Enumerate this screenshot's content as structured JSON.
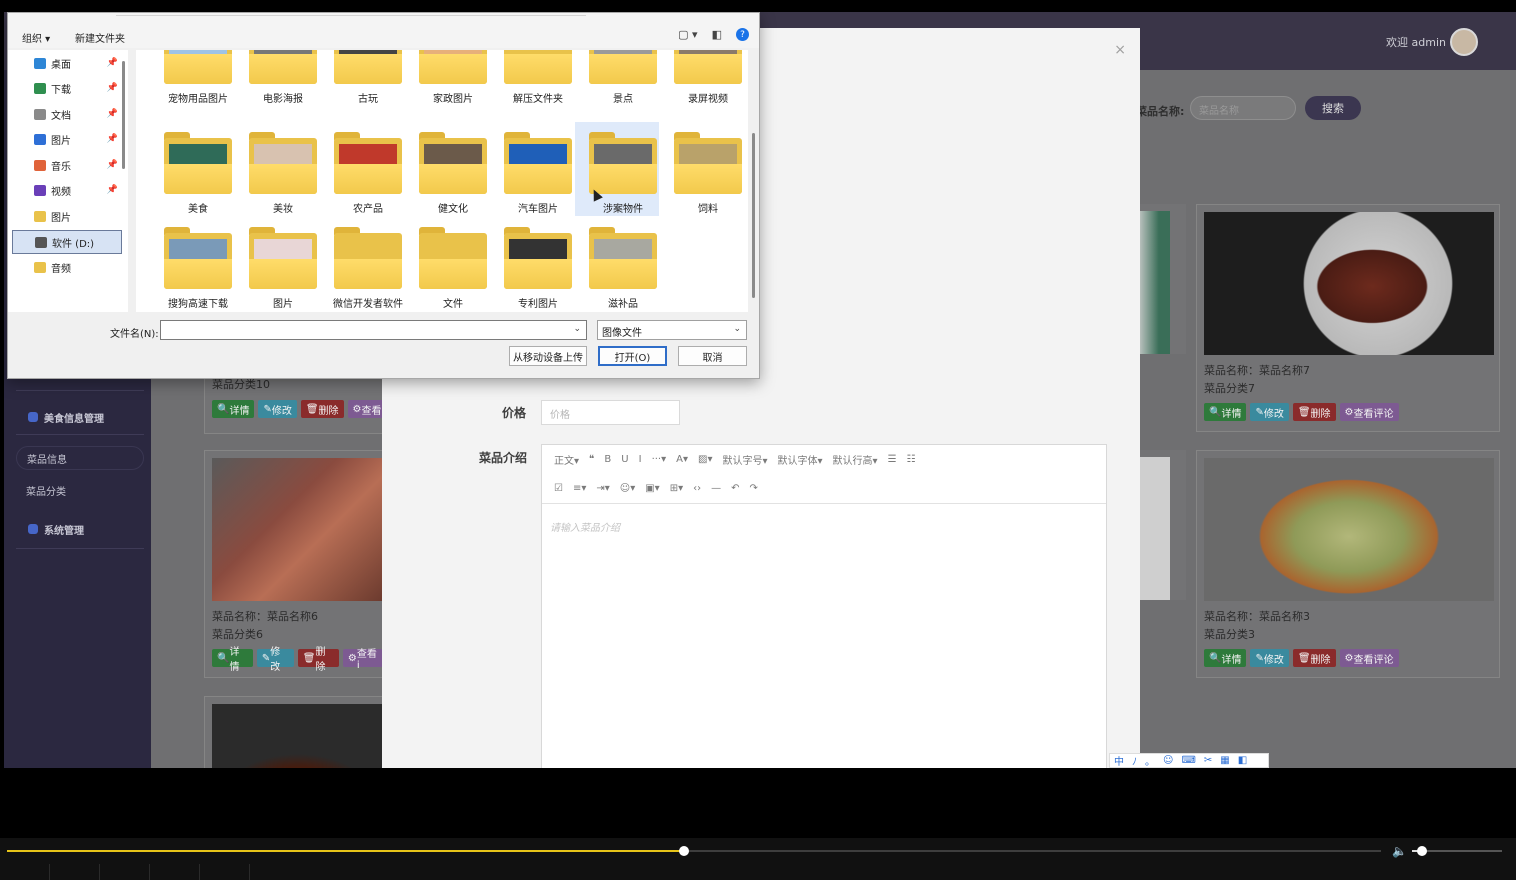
{
  "admin": {
    "welcome": "欢迎 admin",
    "sidebar": {
      "group_food": "美食信息管理",
      "sub_food_info": "菜品信息",
      "sub_food_category": "菜品分类",
      "group_system": "系统管理"
    },
    "search": {
      "label": "菜品名称:",
      "placeholder": "菜品名称",
      "button": "搜索"
    },
    "cards": [
      {
        "name": "菜品名称：菜品名称7",
        "category": "菜品分类7"
      },
      {
        "name": "菜品名称：菜品名称6",
        "category": "菜品分类6"
      },
      {
        "name": "菜品名称：菜品名称3",
        "category": "菜品分类3"
      },
      {
        "name": "",
        "category": "菜品分类10"
      }
    ],
    "card_buttons": {
      "detail": "详情",
      "edit": "修改",
      "delete": "删除",
      "comments": "查看评论",
      "comments_short": "查看i"
    }
  },
  "editor_modal": {
    "price_label": "价格",
    "price_placeholder": "价格",
    "intro_label": "菜品介绍",
    "toolbar_row1": [
      "正文▾",
      "❝",
      "B",
      "U",
      "I",
      "···▾",
      "A▾",
      "▨▾",
      "默认字号▾",
      "默认字体▾",
      "默认行高▾",
      "☰",
      "☷"
    ],
    "toolbar_row2": [
      "☑",
      "≡▾",
      "⇥▾",
      "☺▾",
      "▣▾",
      "⊞▾",
      "‹›",
      "—",
      "↶",
      "↷"
    ],
    "editor_placeholder": "请输入菜品介绍",
    "close": "×",
    "ime": [
      "中",
      "ﾉ",
      "。",
      "☺",
      "⌨",
      "✂",
      "▦",
      "◧"
    ]
  },
  "file_dialog": {
    "organize": "组织 ▾",
    "new_folder": "新建文件夹",
    "nav": [
      {
        "label": "桌面",
        "pinned": true,
        "color": "#2e86d6"
      },
      {
        "label": "下载",
        "pinned": true,
        "color": "#2f8f4f"
      },
      {
        "label": "文档",
        "pinned": true,
        "color": "#8a8a8a"
      },
      {
        "label": "图片",
        "pinned": true,
        "color": "#2e6fd6"
      },
      {
        "label": "音乐",
        "pinned": true,
        "color": "#e0633a"
      },
      {
        "label": "视频",
        "pinned": true,
        "color": "#6a3fb8"
      },
      {
        "label": "图片",
        "pinned": false,
        "color": "#e9c24a"
      },
      {
        "label": "软件 (D:)",
        "pinned": false,
        "color": "#555555"
      },
      {
        "label": "音频",
        "pinned": false,
        "color": "#e9c24a"
      }
    ],
    "folders": [
      {
        "name": "宠物用品图片",
        "thumb": "#9ec3e6"
      },
      {
        "name": "电影海报",
        "thumb": "#777777"
      },
      {
        "name": "古玩",
        "thumb": "#444444"
      },
      {
        "name": "家政图片",
        "thumb": "#e7b07a"
      },
      {
        "name": "解压文件夹",
        "thumb": ""
      },
      {
        "name": "景点",
        "thumb": "#9a9a9a"
      },
      {
        "name": "录屏视频",
        "thumb": "#8a7a6a"
      },
      {
        "name": "美食",
        "thumb": "#2f6b58"
      },
      {
        "name": "美妆",
        "thumb": "#d8c2b0"
      },
      {
        "name": "农产品",
        "thumb": "#c0392b"
      },
      {
        "name": "健文化",
        "thumb": "#6b5a4a"
      },
      {
        "name": "汽车图片",
        "thumb": "#1f5fb8"
      },
      {
        "name": "涉案物件",
        "thumb": "#6a6a6a"
      },
      {
        "name": "饲料",
        "thumb": "#b9a26a"
      },
      {
        "name": "搜狗高速下载",
        "thumb": "#7a9ab8"
      },
      {
        "name": "图片",
        "thumb": "#e8d6d6"
      },
      {
        "name": "微信开发者软件",
        "thumb": ""
      },
      {
        "name": "文件",
        "thumb": ""
      },
      {
        "name": "专利图片",
        "thumb": "#333333"
      },
      {
        "name": "滋补品",
        "thumb": "#a8a8a0"
      }
    ],
    "selected_folder": "涉案物件",
    "filename_label": "文件名(N):",
    "filename_value": "",
    "filetype_value": "图像文件",
    "mobile_upload": "从移动设备上传",
    "open": "打开(O)",
    "cancel": "取消"
  },
  "player": {
    "progress": 0.4926,
    "volume": 0.11,
    "mute_icon": "🔈"
  }
}
